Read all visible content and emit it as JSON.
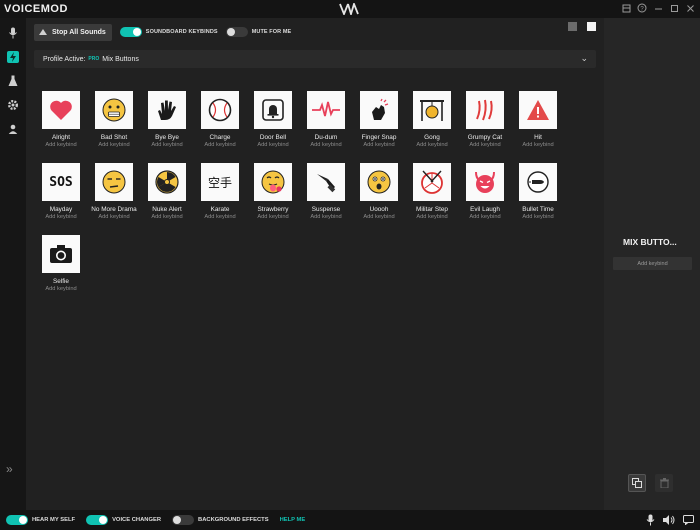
{
  "app": {
    "title": "VOICEMOD"
  },
  "toolbar": {
    "stop_label": "Stop All Sounds",
    "soundboard_keybinds_label": "SOUNDBOARD KEYBINDS",
    "soundboard_keybinds_on": true,
    "mute_for_me_label": "MUTE FOR ME",
    "mute_for_me_on": false
  },
  "profile": {
    "prefix": "Profile Active:",
    "badge": "PRO",
    "name": "Mix Buttons"
  },
  "sounds": [
    {
      "name": "Alright",
      "keybind": "Add keybind",
      "icon": "heart-icon"
    },
    {
      "name": "Bad Shot",
      "keybind": "Add keybind",
      "icon": "grimace-emoji-icon"
    },
    {
      "name": "Bye Bye",
      "keybind": "Add keybind",
      "icon": "waving-hand-icon"
    },
    {
      "name": "Charge",
      "keybind": "Add keybind",
      "icon": "baseball-icon"
    },
    {
      "name": "Door Bell",
      "keybind": "Add keybind",
      "icon": "doorbell-icon"
    },
    {
      "name": "Du-dum",
      "keybind": "Add keybind",
      "icon": "heartbeat-icon"
    },
    {
      "name": "Finger Snap",
      "keybind": "Add keybind",
      "icon": "finger-snap-icon"
    },
    {
      "name": "Gong",
      "keybind": "Add keybind",
      "icon": "gong-icon"
    },
    {
      "name": "Grumpy Cat",
      "keybind": "Add keybind",
      "icon": "claw-scratch-icon"
    },
    {
      "name": "Hit",
      "keybind": "Add keybind",
      "icon": "warning-icon"
    },
    {
      "name": "Mayday",
      "keybind": "Add keybind",
      "icon": "sos-icon",
      "text": "SOS"
    },
    {
      "name": "No More Drama",
      "keybind": "Add keybind",
      "icon": "unamused-emoji-icon"
    },
    {
      "name": "Nuke Alert",
      "keybind": "Add keybind",
      "icon": "radiation-icon"
    },
    {
      "name": "Karate",
      "keybind": "Add keybind",
      "icon": "karate-kanji-icon",
      "text": "空手"
    },
    {
      "name": "Strawberry",
      "keybind": "Add keybind",
      "icon": "tongue-emoji-icon"
    },
    {
      "name": "Suspense",
      "keybind": "Add keybind",
      "icon": "knife-icon"
    },
    {
      "name": "Uoooh",
      "keybind": "Add keybind",
      "icon": "surprised-emoji-icon"
    },
    {
      "name": "Militar Step",
      "keybind": "Add keybind",
      "icon": "snare-drum-icon"
    },
    {
      "name": "Evil Laugh",
      "keybind": "Add keybind",
      "icon": "devil-icon"
    },
    {
      "name": "Bullet Time",
      "keybind": "Add keybind",
      "icon": "bullet-icon"
    },
    {
      "name": "Selfie",
      "keybind": "Add keybind",
      "icon": "camera-icon"
    }
  ],
  "panel": {
    "title": "MIX BUTTO...",
    "keybind": "Add keybind"
  },
  "bottom": {
    "hear_my_self": "HEAR MY SELF",
    "hear_my_self_on": true,
    "voice_changer": "VOICE CHANGER",
    "voice_changer_on": true,
    "background_effects": "BACKGROUND EFFECTS",
    "background_effects_on": false,
    "help": "HELP ME"
  },
  "colors": {
    "accent": "#10c3b3",
    "heart": "#e8405a",
    "alert": "#e34a4a",
    "emoji": "#f5c542"
  }
}
